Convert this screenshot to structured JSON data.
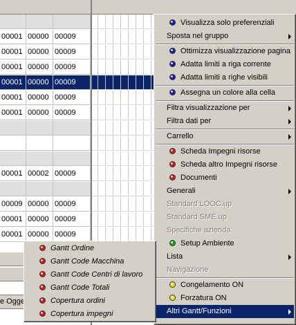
{
  "grid": {
    "rows": [
      {
        "c1": "",
        "c2": "",
        "c3": "",
        "flag": false,
        "kind": "header-gray"
      },
      {
        "c1": "00001",
        "c2": "00000",
        "c3": "00009",
        "flag": true
      },
      {
        "c1": "00001",
        "c2": "00000",
        "c3": "00009",
        "flag": true
      },
      {
        "c1": "00001",
        "c2": "00000",
        "c3": "00009",
        "flag": true
      },
      {
        "c1": "00001",
        "c2": "00000",
        "c3": "00009",
        "flag": true,
        "selected": true
      },
      {
        "c1": "00001",
        "c2": "00000",
        "c3": "00009",
        "flag": true
      },
      {
        "c1": "00001",
        "c2": "00000",
        "c3": "00009",
        "flag": true
      },
      {
        "c1": "",
        "c2": "",
        "c3": "",
        "flag": false,
        "gray": true
      },
      {
        "c1": "",
        "c2": "",
        "c3": "",
        "flag": false
      },
      {
        "c1": "",
        "c2": "",
        "c3": "",
        "flag": false,
        "gray": true
      },
      {
        "c1": "00001",
        "c2": "00002",
        "c3": "00009",
        "flag": true
      },
      {
        "c1": "",
        "c2": "",
        "c3": "",
        "flag": false,
        "gray": true
      },
      {
        "c1": "00009",
        "c2": "00000",
        "c3": "00009",
        "flag": true
      },
      {
        "c1": "00001",
        "c2": "00000",
        "c3": "00009",
        "flag": true
      },
      {
        "c1": "00001",
        "c2": "00000",
        "c3": "00009",
        "flag": true
      }
    ],
    "oggetti_label": "e Ogget"
  },
  "context_menu": {
    "items": [
      {
        "label": "Visualizza solo preferenziali",
        "dot": "blue"
      },
      {
        "label": "Sposta nel gruppo",
        "submenu": true
      },
      {
        "sep": true
      },
      {
        "label": "Ottimizza visualizzazione pagina",
        "dot": "blue"
      },
      {
        "label": "Adatta limiti a riga corrente",
        "dot": "blue"
      },
      {
        "label": "Adatta limiti a righe visibili",
        "dot": "blue"
      },
      {
        "sep": true
      },
      {
        "label": "Assegna un colore alla cella",
        "dot": "blue"
      },
      {
        "sep": true
      },
      {
        "label": "Filtra visualizzazione per",
        "submenu": true
      },
      {
        "label": "Filtra dati per",
        "submenu": true
      },
      {
        "sep": true
      },
      {
        "label": "Carrello",
        "submenu": true
      },
      {
        "sep": true
      },
      {
        "label": "Scheda Impegni risorse",
        "dot": "red"
      },
      {
        "label": "Scheda altro Impegni risorse",
        "dot": "red"
      },
      {
        "label": "Documenti",
        "dot": "red"
      },
      {
        "label": "Generali",
        "submenu": true
      },
      {
        "label": "Standard LOOC.up",
        "disabled": true
      },
      {
        "label": "Standard SME.up",
        "disabled": true
      },
      {
        "label": "Specifiche azienda",
        "disabled": true
      },
      {
        "label": "Setup Ambiente",
        "dot": "green"
      },
      {
        "label": "Lista",
        "submenu": true
      },
      {
        "label": "Navigazione",
        "disabled": true
      },
      {
        "sep": true
      },
      {
        "label": "Congelamento ON",
        "dot": "yellow"
      },
      {
        "label": "Forzatura ON",
        "dot": "yellow"
      },
      {
        "label": "Altri Gantt/Funzioni",
        "submenu": true,
        "active": true
      }
    ]
  },
  "submenu": {
    "items": [
      {
        "label": "Gantt Ordine",
        "dot": "red"
      },
      {
        "label": "Gantt Code Macchina",
        "dot": "red"
      },
      {
        "label": "Gantt Code Centri di lavoro",
        "dot": "red"
      },
      {
        "label": "Gantt Code Totali",
        "dot": "red"
      },
      {
        "label": "Copertura ordini",
        "dot": "red"
      },
      {
        "label": "Copertura impegni",
        "dot": "red"
      }
    ]
  }
}
